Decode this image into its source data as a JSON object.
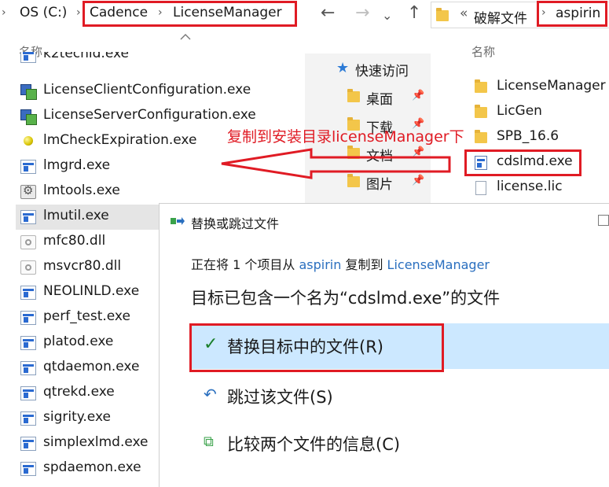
{
  "left_explorer": {
    "breadcrumb": [
      "OS (C:)",
      "Cadence",
      "LicenseManager"
    ],
    "column_header": "名称",
    "files": [
      {
        "name": "k2techid.exe",
        "icon": "exe-icon"
      },
      {
        "name": "LicenseClientConfiguration.exe",
        "icon": "config-app-icon"
      },
      {
        "name": "LicenseServerConfiguration.exe",
        "icon": "config-app-icon"
      },
      {
        "name": "lmCheckExpiration.exe",
        "icon": "yellow-ball-icon"
      },
      {
        "name": "lmgrd.exe",
        "icon": "exe-icon"
      },
      {
        "name": "lmtools.exe",
        "icon": "tools-icon"
      },
      {
        "name": "lmutil.exe",
        "icon": "exe-icon"
      },
      {
        "name": "mfc80.dll",
        "icon": "dll-icon"
      },
      {
        "name": "msvcr80.dll",
        "icon": "dll-icon"
      },
      {
        "name": "NEOLINLD.exe",
        "icon": "exe-icon"
      },
      {
        "name": "perf_test.exe",
        "icon": "exe-icon"
      },
      {
        "name": "platod.exe",
        "icon": "exe-icon"
      },
      {
        "name": "qtdaemon.exe",
        "icon": "exe-icon"
      },
      {
        "name": "qtrekd.exe",
        "icon": "exe-icon"
      },
      {
        "name": "sigrity.exe",
        "icon": "exe-icon"
      },
      {
        "name": "simplexlmd.exe",
        "icon": "exe-icon"
      },
      {
        "name": "spdaemon.exe",
        "icon": "exe-icon"
      }
    ],
    "selected_file": "lmutil.exe"
  },
  "right_explorer": {
    "breadcrumb": [
      "«",
      "破解文件",
      "aspirin"
    ],
    "column_header": "名称",
    "nav_tree": [
      {
        "label": "快速访问",
        "icon": "star-icon"
      },
      {
        "label": "桌面",
        "icon": "folder-icon"
      },
      {
        "label": "下载",
        "icon": "download-folder-icon"
      },
      {
        "label": "文档",
        "icon": "folder-icon"
      },
      {
        "label": "图片",
        "icon": "folder-icon"
      }
    ],
    "files": [
      {
        "name": "LicenseManager",
        "icon": "folder-icon"
      },
      {
        "name": "LicGen",
        "icon": "folder-icon"
      },
      {
        "name": "SPB_16.6",
        "icon": "folder-icon"
      },
      {
        "name": "cdslmd.exe",
        "icon": "exe-icon"
      },
      {
        "name": "license.lic",
        "icon": "document-icon"
      }
    ]
  },
  "annotation": {
    "text": "复制到安装目录licenseManager下",
    "color": "#e01b24"
  },
  "dialog": {
    "title": "替换或跳过文件",
    "line1": {
      "prefix": "正在将 1 个项目从 ",
      "source": "aspirin",
      "middle": " 复制到 ",
      "destination": "LicenseManager"
    },
    "line2": "目标已包含一个名为“cdslmd.exe”的文件",
    "options": [
      {
        "label": "替换目标中的文件(R)",
        "icon": "checkmark-icon"
      },
      {
        "label": "跳过该文件(S)",
        "icon": "skip-arrow-icon"
      },
      {
        "label": "比较两个文件的信息(C)",
        "icon": "compare-icon"
      }
    ],
    "highlight_color": "#cce8ff",
    "link_color": "#2a6fbf"
  }
}
